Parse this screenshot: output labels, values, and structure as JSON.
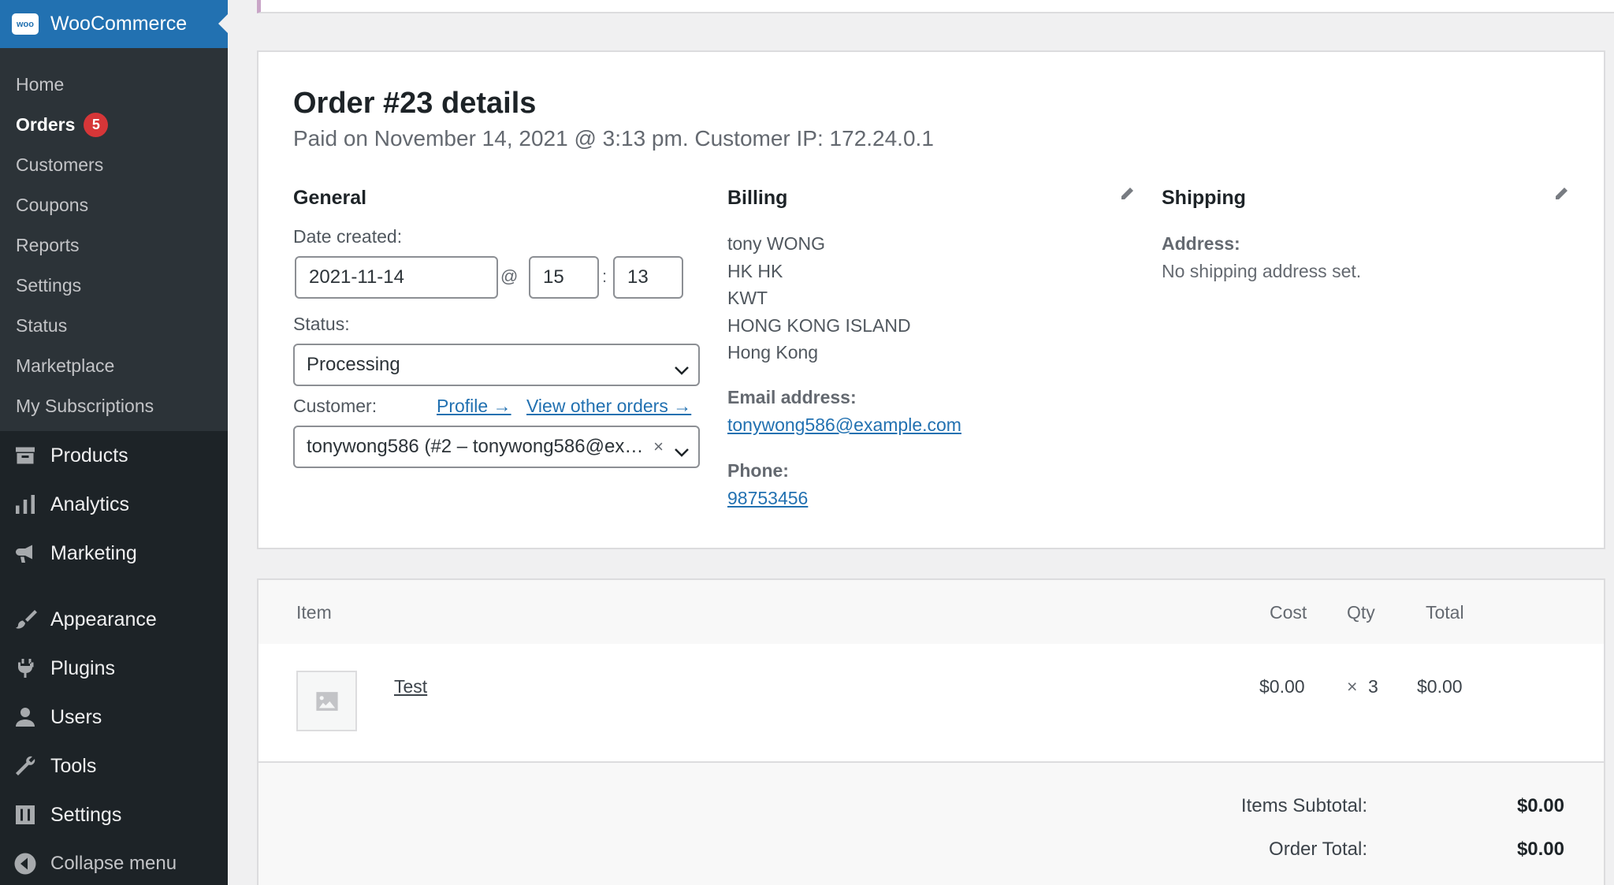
{
  "sidebar": {
    "brand": "WooCommerce",
    "logo_text": "woo",
    "submenu": [
      {
        "label": "Home"
      },
      {
        "label": "Orders",
        "badge": "5"
      },
      {
        "label": "Customers"
      },
      {
        "label": "Coupons"
      },
      {
        "label": "Reports"
      },
      {
        "label": "Settings"
      },
      {
        "label": "Status"
      },
      {
        "label": "Marketplace"
      },
      {
        "label": "My Subscriptions"
      }
    ],
    "menu": [
      {
        "label": "Products",
        "icon": "archive-icon"
      },
      {
        "label": "Analytics",
        "icon": "bar-chart-icon"
      },
      {
        "label": "Marketing",
        "icon": "megaphone-icon"
      },
      {
        "label": "Appearance",
        "icon": "paintbrush-icon"
      },
      {
        "label": "Plugins",
        "icon": "plug-icon"
      },
      {
        "label": "Users",
        "icon": "user-icon"
      },
      {
        "label": "Tools",
        "icon": "wrench-icon"
      },
      {
        "label": "Settings",
        "icon": "sliders-icon"
      },
      {
        "label": "Collapse menu",
        "icon": "collapse-arrow-icon"
      }
    ]
  },
  "order": {
    "title": "Order #23 details",
    "meta": "Paid on November 14, 2021 @ 3:13 pm. Customer IP: 172.24.0.1",
    "general": {
      "heading": "General",
      "date_label": "Date created:",
      "date": "2021-11-14",
      "at": "@",
      "hour": "15",
      "colon": ":",
      "minute": "13",
      "status_label": "Status:",
      "status": "Processing",
      "customer_label": "Customer:",
      "profile_link": "Profile →",
      "other_orders_link": "View other orders →",
      "customer": "tonywong586 (#2 – tonywong586@ex…",
      "clear": "×"
    },
    "billing": {
      "heading": "Billing",
      "address_lines": [
        "tony WONG",
        "HK HK",
        "KWT",
        "HONG KONG ISLAND",
        "Hong Kong"
      ],
      "email_label": "Email address:",
      "email": "tonywong586@example.com",
      "phone_label": "Phone:",
      "phone": "98753456"
    },
    "shipping": {
      "heading": "Shipping",
      "address_label": "Address:",
      "address": "No shipping address set."
    }
  },
  "items": {
    "headers": {
      "item": "Item",
      "cost": "Cost",
      "qty": "Qty",
      "total": "Total"
    },
    "rows": [
      {
        "name": "Test",
        "cost": "$0.00",
        "qty_x": "×",
        "qty": "3",
        "total": "$0.00"
      }
    ],
    "totals": {
      "subtotal_label": "Items Subtotal:",
      "subtotal": "$0.00",
      "order_total_label": "Order Total:",
      "order_total": "$0.00"
    }
  },
  "colors": {
    "brand_blue": "#2271b1",
    "sidebar_bg": "#1d2327",
    "submenu_bg": "#2c3338",
    "badge_red": "#d63638",
    "link": "#2271b1"
  }
}
